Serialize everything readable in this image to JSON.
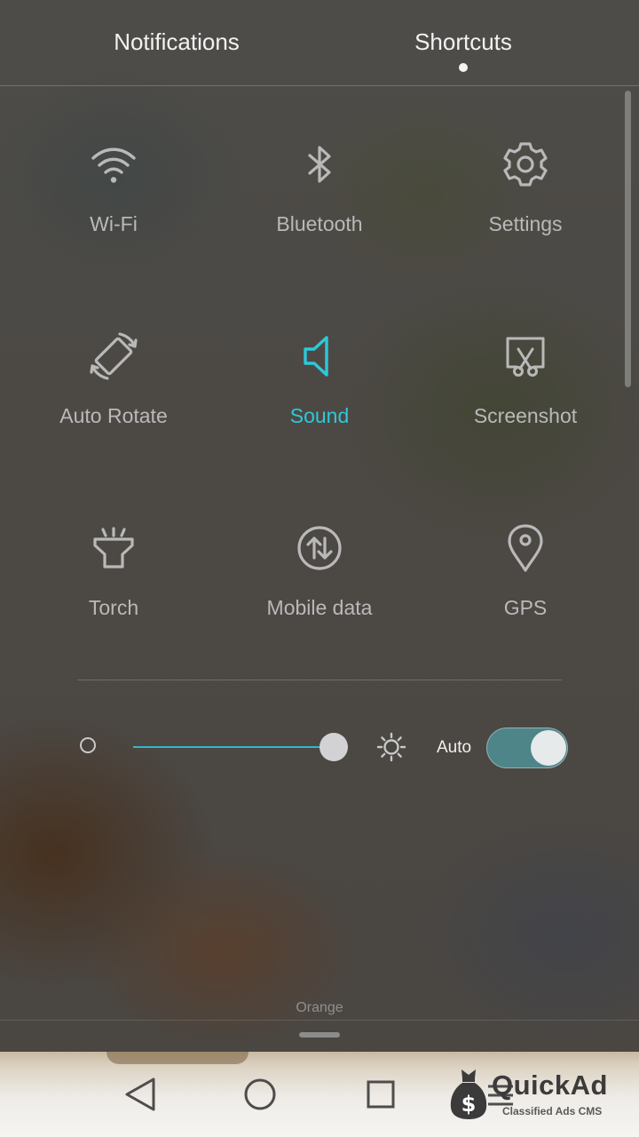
{
  "tabs": {
    "notifications": "Notifications",
    "shortcuts": "Shortcuts",
    "active": "Shortcuts"
  },
  "tiles": [
    {
      "label": "Wi-Fi",
      "icon": "wifi-icon",
      "active": false
    },
    {
      "label": "Bluetooth",
      "icon": "bluetooth-icon",
      "active": false
    },
    {
      "label": "Settings",
      "icon": "gear-icon",
      "active": false
    },
    {
      "label": "Auto Rotate",
      "icon": "auto-rotate-icon",
      "active": false
    },
    {
      "label": "Sound",
      "icon": "speaker-icon",
      "active": true
    },
    {
      "label": "Screenshot",
      "icon": "screenshot-icon",
      "active": false
    },
    {
      "label": "Torch",
      "icon": "torch-icon",
      "active": false
    },
    {
      "label": "Mobile data",
      "icon": "mobile-data-icon",
      "active": false
    },
    {
      "label": "GPS",
      "icon": "location-pin-icon",
      "active": false
    }
  ],
  "brightness": {
    "level": 1.0,
    "auto_label": "Auto",
    "auto_enabled": true
  },
  "carrier": "Orange",
  "navbar": {
    "buttons": [
      "back-icon",
      "home-icon",
      "recents-icon",
      "menu-icon"
    ]
  },
  "watermark": {
    "title": "QuickAd",
    "subtitle": "Classified Ads CMS",
    "symbol": "$"
  },
  "colors": {
    "accent": "#2ec8d9",
    "inactive_icon": "#b9b9b9",
    "toggle_on": "#4e8589"
  }
}
